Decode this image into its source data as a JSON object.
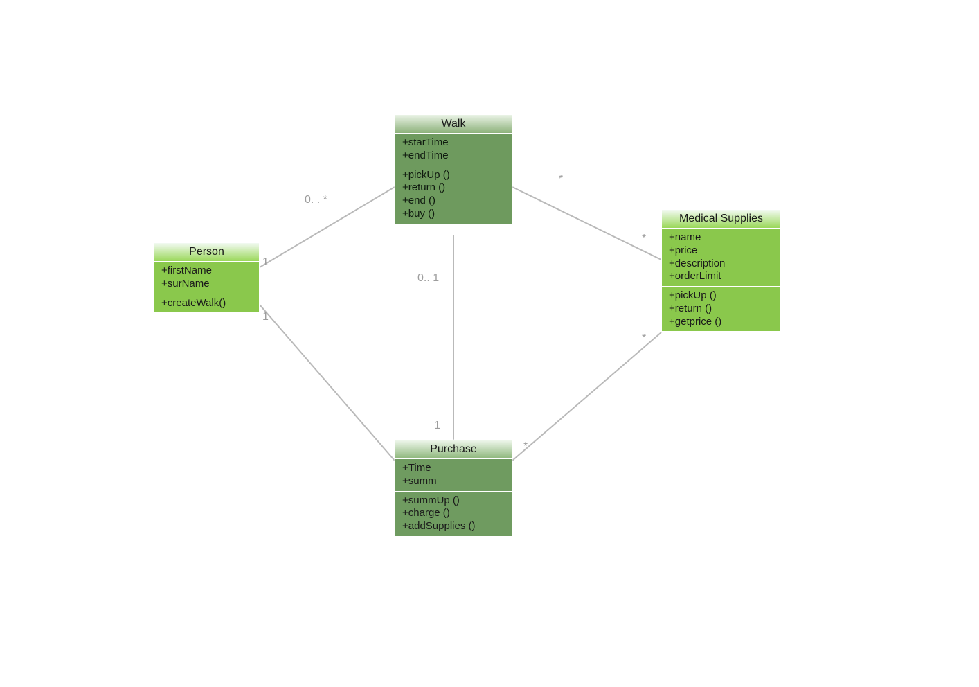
{
  "classes": {
    "person": {
      "name": "Person",
      "attributes": [
        "+firstName",
        "+surName"
      ],
      "operations": [
        "+createWalk()"
      ]
    },
    "walk": {
      "name": "Walk",
      "attributes": [
        "+starTime",
        "+endTime"
      ],
      "operations": [
        "+pickUp ()",
        "+return ()",
        "+end ()",
        "+buy ()"
      ]
    },
    "medical": {
      "name": "Medical Supplies",
      "attributes": [
        "+name",
        "+price",
        "+description",
        "+orderLimit"
      ],
      "operations": [
        "+pickUp ()",
        "+return ()",
        "+getprice ()"
      ]
    },
    "purchase": {
      "name": "Purchase",
      "attributes": [
        "+Time",
        "+summ"
      ],
      "operations": [
        "+summUp ()",
        "+charge ()",
        "+addSupplies ()"
      ]
    }
  },
  "multiplicities": {
    "person_walk_person": "1",
    "person_walk_walk": "0. . *",
    "person_purchase_person": "1",
    "walk_medical_walk": "*",
    "walk_medical_medical": "*",
    "purchase_medical_purchase": "*",
    "purchase_medical_medical": "*",
    "walk_purchase_walk": "0.. 1",
    "walk_purchase_purchase": "1"
  }
}
